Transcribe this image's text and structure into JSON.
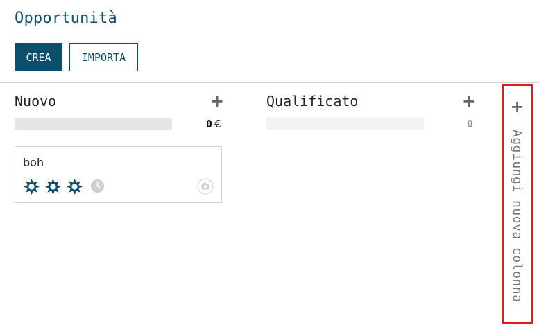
{
  "header": {
    "title": "Opportunità",
    "create_label": "CREA",
    "import_label": "IMPORTA"
  },
  "columns": [
    {
      "title": "Nuovo",
      "add_symbol": "+",
      "total": "0",
      "currency": "€",
      "progress": 1.0
    },
    {
      "title": "Qualificato",
      "add_symbol": "+",
      "total": "0",
      "currency": "",
      "progress": 1.0
    }
  ],
  "cards": [
    {
      "title": "boh",
      "priority_stars": 3,
      "max_stars": 3,
      "icons": [
        "star-icon",
        "clock-icon",
        "camera-icon"
      ]
    }
  ],
  "add_column": {
    "symbol": "+",
    "label": "Aggiungi nuova colonna"
  },
  "colors": {
    "primary": "#0b4f6c",
    "highlight": "#e01b1b"
  }
}
